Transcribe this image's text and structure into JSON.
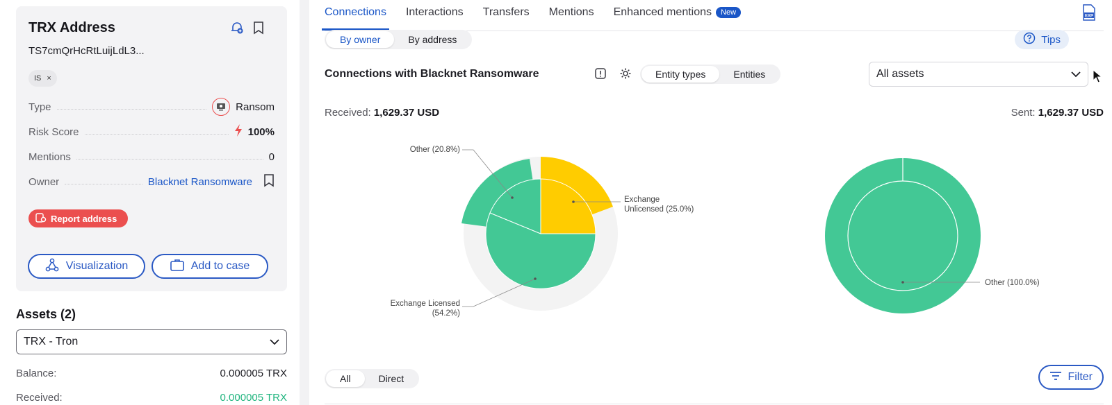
{
  "address_card": {
    "title": "TRX Address",
    "hash": "TS7cmQrHcRtLuijLdL3...",
    "tag": "IS",
    "tag_close": "×",
    "rows": [
      {
        "label": "Type",
        "value": "Ransom",
        "icon": "ransom-icon"
      },
      {
        "label": "Risk Score",
        "value": "100%",
        "icon": "lightning-icon"
      },
      {
        "label": "Mentions",
        "value": "0"
      },
      {
        "label": "Owner",
        "value": "Blacknet Ransomware",
        "icon": "bookmark-icon"
      }
    ],
    "report_button": "Report address",
    "visualization_button": "Visualization",
    "add_to_case_button": "Add to case"
  },
  "assets": {
    "title": "Assets (2)",
    "selected": "TRX - Tron",
    "balance_label": "Balance:",
    "balance_value": "0.000005 TRX",
    "received_label": "Received:",
    "received_value": "0.000005 TRX"
  },
  "tabs": [
    {
      "label": "Connections",
      "active": true
    },
    {
      "label": "Interactions"
    },
    {
      "label": "Transfers"
    },
    {
      "label": "Mentions"
    },
    {
      "label": "Enhanced mentions",
      "badge": "New"
    }
  ],
  "view_toggle": {
    "by_owner": "By owner",
    "by_address": "By address"
  },
  "tips": "Tips",
  "connections": {
    "title": "Connections with Blacknet Ransomware",
    "entity_types": "Entity types",
    "entities": "Entities",
    "asset_filter": "All assets",
    "received_label": "Received:",
    "received_value": "1,629.37 USD",
    "sent_label": "Sent:",
    "sent_value": "1,629.37 USD"
  },
  "received_pie": {
    "label_other": "Other (20.8%)",
    "label_unlicensed_1": "Exchange",
    "label_unlicensed_2": "Unlicensed (25.0%)",
    "label_licensed_1": "Exchange Licensed",
    "label_licensed_2": "(54.2%)",
    "slices": [
      {
        "name": "Exchange Unlicensed",
        "share": 25.0,
        "color": "#ffcc00"
      },
      {
        "name": "Exchange Licensed",
        "share": 54.2,
        "color": "#43c895"
      },
      {
        "name": "Other",
        "share": 20.8,
        "color": "#43c895"
      }
    ]
  },
  "sent_pie": {
    "label_other": "Other (100.0%)",
    "slices": [
      {
        "name": "Other",
        "share": 100.0,
        "color": "#43c895"
      }
    ]
  },
  "bottom": {
    "all": "All",
    "direct": "Direct",
    "filter": "Filter"
  },
  "colors": {
    "accent": "#1a56c7",
    "green": "#43c895",
    "yellow": "#ffcc00",
    "danger": "#eb4f4f"
  }
}
